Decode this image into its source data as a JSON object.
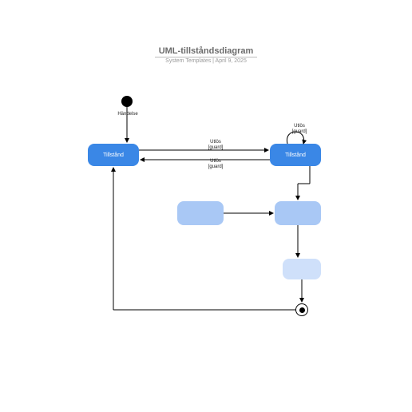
{
  "header": {
    "title": "UML-tillståndsdiagram",
    "subtitle": "System Templates  |  April 9, 2025"
  },
  "initial": {
    "event_label": "Händelse"
  },
  "states": {
    "s1": "Tillstånd",
    "s2": "Tillstånd",
    "s3": "",
    "s4": "",
    "s5": ""
  },
  "transitions": {
    "t12_top": "Utlös",
    "t12_top_guard": "[guard]",
    "t21_bot": "Utlös",
    "t21_bot_guard": "[guard]",
    "self_top": "Utlös",
    "self_top_guard": "[guard]"
  }
}
